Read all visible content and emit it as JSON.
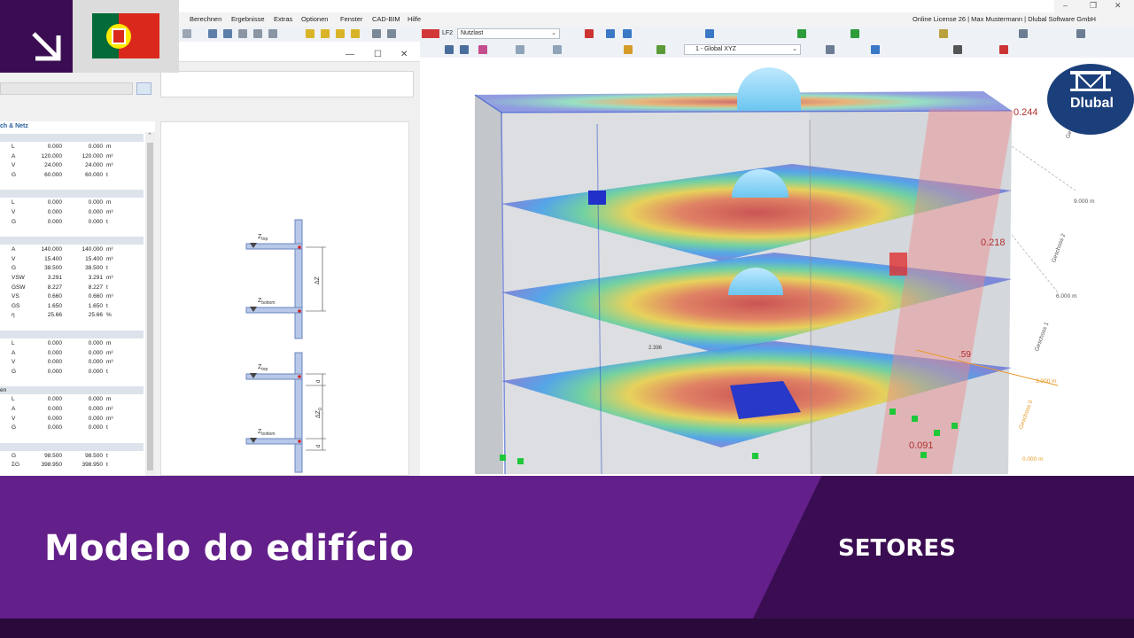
{
  "menu": {
    "items": [
      "Berechnen",
      "Ergebnisse",
      "Extras",
      "Optionen",
      "Fenster",
      "CAD-BIM",
      "Hilfe"
    ],
    "license": "Online License 26 | Max Mustermann | Dlubal Software GmbH"
  },
  "toolbar": {
    "load_case_tag": "LF2",
    "load_case_name": "Nutzlast",
    "coordinate_system": "1 - Global XYZ"
  },
  "table": {
    "header": "ch & Netz",
    "sections": [
      {
        "rows": [
          [
            "L",
            "0.000",
            "0.000",
            "m"
          ],
          [
            "A",
            "120.000",
            "120.000",
            "m²"
          ],
          [
            "V",
            "24.000",
            "24.000",
            "m³"
          ],
          [
            "G",
            "60.000",
            "60.000",
            "t"
          ]
        ]
      },
      {
        "rows": [
          [
            "L",
            "0.000",
            "0.000",
            "m"
          ],
          [
            "V",
            "0.000",
            "0.000",
            "m³"
          ],
          [
            "G",
            "0.000",
            "0.000",
            "t"
          ]
        ]
      },
      {
        "rows": [
          [
            "A",
            "140.000",
            "140.000",
            "m²"
          ],
          [
            "V",
            "15.400",
            "15.400",
            "m³"
          ],
          [
            "G",
            "38.500",
            "38.500",
            "t"
          ],
          [
            "VSW",
            "3.291",
            "3.291",
            "m³"
          ],
          [
            "GSW",
            "8.227",
            "8.227",
            "t"
          ],
          [
            "VS",
            "0.660",
            "0.660",
            "m³"
          ],
          [
            "GS",
            "1.650",
            "1.650",
            "t"
          ],
          [
            "η",
            "25.66",
            "25.66",
            "%"
          ]
        ]
      },
      {
        "rows": [
          [
            "L",
            "0.000",
            "0.000",
            "m"
          ],
          [
            "A",
            "0.000",
            "0.000",
            "m²"
          ],
          [
            "V",
            "0.000",
            "0.000",
            "m³"
          ],
          [
            "G",
            "0.000",
            "0.000",
            "t"
          ]
        ]
      },
      {
        "title": "en",
        "rows": [
          [
            "L",
            "0.000",
            "0.000",
            "m"
          ],
          [
            "A",
            "0.000",
            "0.000",
            "m²"
          ],
          [
            "V",
            "0.000",
            "0.000",
            "m³"
          ],
          [
            "G",
            "0.000",
            "0.000",
            "t"
          ]
        ]
      },
      {
        "rows": [
          [
            "G",
            "98.500",
            "98.500",
            "t"
          ],
          [
            "ΣG",
            "398.950",
            "398.950",
            "t"
          ]
        ]
      }
    ]
  },
  "diagram": {
    "z_top": "Z",
    "z_top_sub": "top",
    "z_bottom": "Z",
    "z_bottom_sub": "bottom",
    "delta_z": "ΔZ",
    "delta_z0": "ΔZ",
    "delta_z0_sub": "0",
    "d": "d"
  },
  "model": {
    "values": [
      "0.244",
      "0.218",
      "0.091",
      "2.396",
      ".59"
    ],
    "storeys": [
      "Geschoss 3",
      "Geschoss 2",
      "Geschoss 1",
      "Geschoss 0"
    ],
    "levels": [
      "9.000 m",
      "6.000 m",
      "3.000 m",
      "0.000 m"
    ]
  },
  "logo": {
    "text": "Dlubal"
  },
  "banner": {
    "title": "Modelo do edifício",
    "subtitle": "SETORES"
  },
  "colors": {
    "banner": "#631f8a",
    "dark_purple": "#3a0d52",
    "logo_blue": "#1b3f7a"
  }
}
